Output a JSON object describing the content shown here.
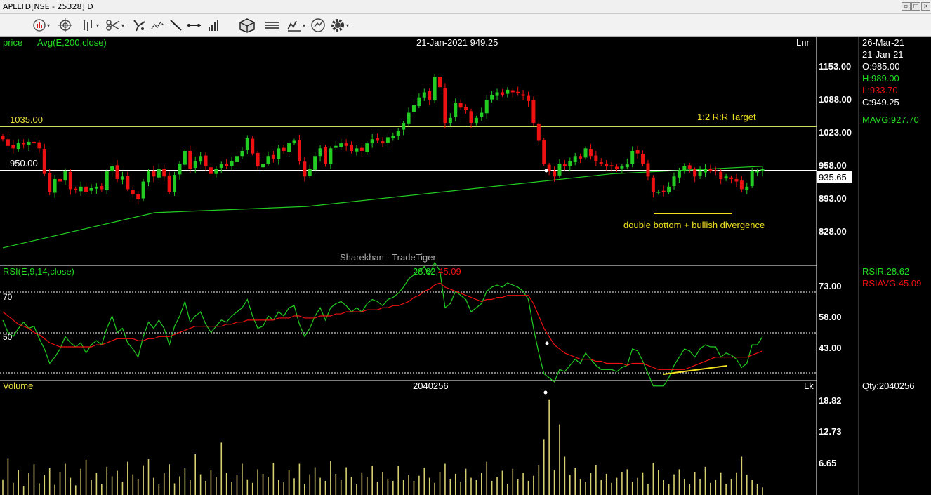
{
  "window": {
    "title": "APLLTD[NSE - 25328] D"
  },
  "toolbar": {
    "icons": [
      "chart-type-icon",
      "crosshair-icon",
      "bar-style-icon",
      "scissors-icon",
      "draw-tools-icon",
      "pattern-icon",
      "trendline-icon",
      "horizontal-line-icon",
      "volume-bars-icon",
      "3d-box-icon",
      "lines-icon",
      "indicator-icon",
      "refresh-icon",
      "settings-gear-icon"
    ]
  },
  "colors": {
    "up": "#22cc22",
    "down": "#ee1111",
    "ma": "#22cc22",
    "rsi": "#22cc22",
    "rsi_avg": "#ee1111",
    "volume": "#d8d070",
    "annotation": "#f0e020",
    "header_green": "#22dd22",
    "axis_text": "#ffffff",
    "neutral_line": "#ffffff"
  },
  "price_panel": {
    "label": "price",
    "indicator": "Avg(E,200,close)",
    "cursor": "21-Jan-2021 949.25",
    "scale_mode": "Lnr",
    "watermark": "Sharekhan - TradeTiger",
    "level_1": "1035.00",
    "level_2": "950.00",
    "target_label": "1:2 R:R Target",
    "annotation": "double bottom + bullish divergence",
    "ticks": [
      "1153.00",
      "1088.00",
      "1023.00",
      "958.00",
      "893.00",
      "828.00"
    ],
    "last_price": "935.65"
  },
  "rsi_panel": {
    "label": "RSI(E,9,14,close)",
    "value_rsi": "28.62",
    "value_sep": ",",
    "value_avg": "45.09",
    "level_70": "70",
    "level_50": "50",
    "ticks": [
      "73.00",
      "58.00",
      "43.00"
    ]
  },
  "volume_panel": {
    "label": "Volume",
    "value": "2040256",
    "unit": "Lk",
    "ticks": [
      "18.82",
      "12.73",
      "6.65"
    ]
  },
  "info_panel": {
    "date1": "26-Mar-21",
    "date2": "21-Jan-21",
    "open": "O:985.00",
    "high": "H:989.00",
    "low": "L:933.70",
    "close": "C:949.25",
    "mavg": "MAVG:927.70",
    "rsir": "RSIR:28.62",
    "rsiavg": "RSIAVG:45.09",
    "qty": "Qty:2040256"
  },
  "chart_data": [
    {
      "type": "candlestick",
      "title": "APLLTD[NSE - 25328] D",
      "price_range": [
        790,
        1180
      ],
      "closes": [
        1008,
        995,
        990,
        1000,
        998,
        1003,
        1000,
        990,
        940,
        905,
        930,
        925,
        945,
        910,
        908,
        915,
        905,
        912,
        915,
        910,
        945,
        955,
        930,
        935,
        910,
        900,
        890,
        925,
        945,
        935,
        950,
        935,
        905,
        938,
        960,
        985,
        950,
        965,
        975,
        955,
        940,
        950,
        960,
        955,
        965,
        975,
        985,
        1010,
        980,
        955,
        960,
        975,
        970,
        990,
        985,
        1000,
        1005,
        965,
        935,
        950,
        975,
        990,
        960,
        990,
        995,
        1000,
        995,
        985,
        990,
        985,
        1000,
        1008,
        1005,
        1000,
        1012,
        1015,
        1025,
        1040,
        1060,
        1075,
        1090,
        1100,
        1085,
        1130,
        1110,
        1040,
        1050,
        1080,
        1070,
        1065,
        1040,
        1050,
        1060,
        1085,
        1095,
        1100,
        1095,
        1105,
        1100,
        1098,
        1093,
        1083,
        1040,
        1005,
        960,
        945,
        935,
        960,
        955,
        965,
        975,
        970,
        990,
        975,
        965,
        960,
        955,
        955,
        950,
        955,
        960,
        985,
        980,
        960,
        935,
        905,
        905,
        905,
        915,
        935,
        945,
        955,
        950,
        935,
        945,
        950,
        945,
        945,
        930,
        935,
        930,
        925,
        910,
        915,
        945,
        945,
        950
      ],
      "ma200": [
        795,
        864,
        876,
        908,
        940,
        955
      ],
      "hlines": [
        1035,
        950
      ],
      "annotation": "double bottom + bullish divergence"
    },
    {
      "type": "line",
      "title": "RSI(E,9,14,close)",
      "ylim": [
        18,
        88
      ],
      "levels": [
        70,
        50
      ],
      "series": [
        {
          "name": "RSIR",
          "values": [
            56,
            50,
            48,
            52,
            55,
            52,
            53,
            47,
            42,
            35,
            38,
            42,
            48,
            45,
            43,
            45,
            40,
            44,
            46,
            44,
            52,
            58,
            50,
            52,
            45,
            42,
            38,
            48,
            55,
            52,
            56,
            52,
            44,
            53,
            58,
            65,
            55,
            58,
            60,
            54,
            50,
            53,
            56,
            55,
            58,
            60,
            62,
            66,
            58,
            52,
            53,
            58,
            56,
            60,
            58,
            62,
            63,
            54,
            48,
            52,
            58,
            62,
            56,
            62,
            64,
            65,
            63,
            60,
            62,
            60,
            64,
            66,
            65,
            63,
            66,
            67,
            69,
            72,
            76,
            78,
            80,
            82,
            78,
            84,
            80,
            62,
            64,
            70,
            68,
            66,
            60,
            62,
            64,
            70,
            72,
            73,
            72,
            74,
            73,
            72,
            70,
            66,
            52,
            40,
            30,
            28,
            26,
            32,
            31,
            34,
            37,
            35,
            40,
            37,
            34,
            32,
            32,
            32,
            31,
            33,
            34,
            42,
            41,
            36,
            30,
            24,
            24,
            24,
            28,
            34,
            38,
            42,
            41,
            38,
            42,
            44,
            43,
            43,
            38,
            40,
            39,
            37,
            33,
            35,
            44,
            44,
            48
          ]
        },
        {
          "name": "RSIAVG",
          "values": [
            60,
            58,
            56,
            54,
            53,
            52,
            50,
            49,
            47,
            45,
            44,
            43,
            43,
            43,
            43,
            43,
            43,
            43,
            44,
            44,
            45,
            46,
            47,
            47,
            47,
            47,
            46,
            46,
            47,
            47,
            48,
            48,
            48,
            49,
            50,
            51,
            52,
            53,
            53,
            53,
            53,
            53,
            53,
            54,
            54,
            55,
            55,
            56,
            56,
            56,
            56,
            56,
            56,
            57,
            57,
            57,
            58,
            58,
            57,
            57,
            57,
            58,
            58,
            58,
            59,
            59,
            60,
            60,
            60,
            60,
            61,
            61,
            61,
            62,
            62,
            63,
            63,
            64,
            65,
            67,
            68,
            70,
            71,
            73,
            74,
            72,
            71,
            70,
            69,
            68,
            67,
            66,
            65,
            66,
            66,
            67,
            67,
            68,
            68,
            68,
            68,
            68,
            64,
            58,
            52,
            48,
            44,
            42,
            40,
            39,
            38,
            37,
            37,
            37,
            36,
            36,
            35,
            35,
            35,
            35,
            34,
            35,
            35,
            35,
            34,
            33,
            32,
            32,
            32,
            32,
            32,
            32,
            33,
            34,
            35,
            36,
            37,
            38,
            38,
            38,
            38,
            38,
            38,
            38,
            39,
            40,
            41
          ]
        }
      ]
    },
    {
      "type": "bar",
      "title": "Volume",
      "unit": "Lk",
      "ylim": [
        0,
        21
      ],
      "values": [
        3.1,
        7.2,
        2.4,
        5.0,
        1.8,
        4.4,
        6.1,
        2.3,
        3.9,
        5.3,
        2.0,
        4.6,
        6.2,
        3.4,
        1.9,
        5.2,
        7.0,
        3.0,
        4.4,
        2.1,
        5.6,
        3.7,
        4.8,
        2.6,
        6.6,
        4.1,
        3.2,
        5.9,
        7.1,
        3.4,
        2.2,
        4.3,
        6.1,
        2.3,
        3.7,
        5.3,
        3.0,
        8.1,
        4.1,
        2.8,
        5.0,
        3.6,
        10.4,
        4.4,
        2.6,
        4.0,
        6.2,
        3.1,
        2.4,
        5.1,
        4.2,
        3.6,
        6.4,
        3.0,
        2.5,
        5.0,
        3.3,
        6.2,
        2.2,
        4.1,
        5.5,
        3.4,
        2.8,
        6.8,
        4.2,
        3.0,
        5.5,
        3.6,
        2.1,
        4.5,
        3.5,
        5.8,
        2.6,
        4.6,
        3.2,
        2.8,
        5.8,
        3.0,
        4.0,
        2.8,
        3.8,
        5.4,
        3.4,
        2.4,
        4.6,
        6.2,
        3.2,
        4.2,
        2.6,
        5.2,
        3.4,
        3.0,
        4.4,
        6.6,
        2.8,
        3.6,
        4.8,
        2.2,
        5.2,
        3.2,
        4.4,
        2.8,
        3.8,
        6.0,
        11.1,
        19.0,
        5.0,
        14.0,
        7.6,
        4.0,
        5.4,
        3.2,
        2.6,
        4.4,
        6.0,
        3.0,
        4.2,
        2.4,
        3.4,
        4.6,
        5.1,
        2.6,
        3.4,
        4.5,
        2.2,
        6.4,
        5.0,
        3.0,
        2.2,
        4.1,
        5.1,
        3.2,
        2.1,
        4.6,
        3.2,
        5.6,
        2.4,
        3.0,
        4.5,
        2.2,
        3.2,
        4.5,
        7.6,
        4.0,
        3.0,
        2.2,
        1.5
      ]
    }
  ]
}
